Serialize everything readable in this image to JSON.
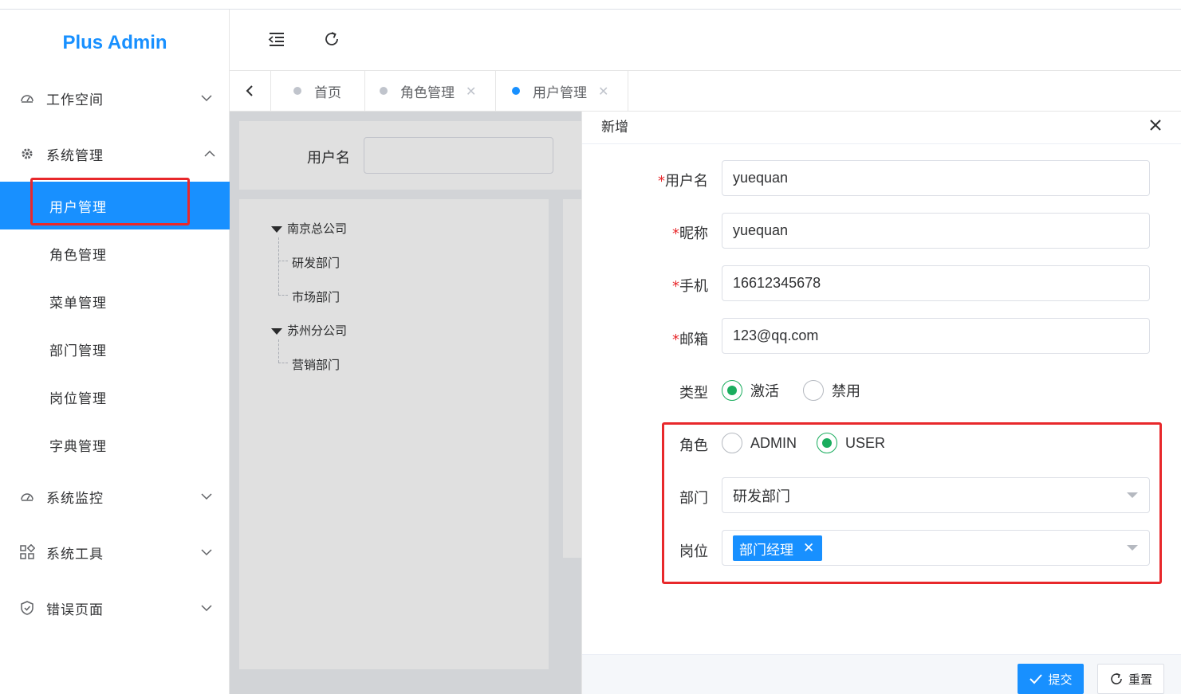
{
  "app": {
    "logo": "Plus Admin"
  },
  "sidebar": {
    "groups": [
      {
        "label": "工作空间",
        "icon": "dashboard-icon",
        "expanded": false
      },
      {
        "label": "系统管理",
        "icon": "gear-icon",
        "expanded": true
      },
      {
        "label": "系统监控",
        "icon": "dashboard-icon",
        "expanded": false
      },
      {
        "label": "系统工具",
        "icon": "grid-icon",
        "expanded": false
      },
      {
        "label": "错误页面",
        "icon": "shield-icon",
        "expanded": false
      }
    ],
    "sub_items": [
      {
        "label": "用户管理",
        "active": true
      },
      {
        "label": "角色管理",
        "active": false
      },
      {
        "label": "菜单管理",
        "active": false
      },
      {
        "label": "部门管理",
        "active": false
      },
      {
        "label": "岗位管理",
        "active": false
      },
      {
        "label": "字典管理",
        "active": false
      }
    ]
  },
  "header": {
    "collapse_icon": "menu-fold-icon",
    "refresh_icon": "refresh-icon"
  },
  "tabs": [
    {
      "label": "首页",
      "closable": false,
      "active": false
    },
    {
      "label": "角色管理",
      "closable": true,
      "active": false
    },
    {
      "label": "用户管理",
      "closable": true,
      "active": true
    }
  ],
  "search": {
    "username_label": "用户名",
    "username_value": ""
  },
  "tree": [
    {
      "label": "南京总公司",
      "children": [
        "研发部门",
        "市场部门"
      ]
    },
    {
      "label": "苏州分公司",
      "children": [
        "营销部门"
      ]
    }
  ],
  "drawer": {
    "title": "新增",
    "fields": {
      "username": {
        "label": "用户名",
        "required": true,
        "value": "yuequan"
      },
      "nickname": {
        "label": "昵称",
        "required": true,
        "value": "yuequan"
      },
      "phone": {
        "label": "手机",
        "required": true,
        "value": "16612345678"
      },
      "email": {
        "label": "邮箱",
        "required": true,
        "value": "123@qq.com"
      },
      "type": {
        "label": "类型",
        "options": [
          "激活",
          "禁用"
        ],
        "selected": "激活"
      },
      "role": {
        "label": "角色",
        "options": [
          "ADMIN",
          "USER"
        ],
        "selected": "USER"
      },
      "dept": {
        "label": "部门",
        "value": "研发部门"
      },
      "post": {
        "label": "岗位",
        "tags": [
          "部门经理"
        ]
      }
    },
    "submit_label": "提交",
    "reset_label": "重置",
    "required_mark": "*"
  },
  "colors": {
    "primary": "#1890ff",
    "radio_checked": "#1aad5e",
    "highlight": "#e8282b"
  }
}
